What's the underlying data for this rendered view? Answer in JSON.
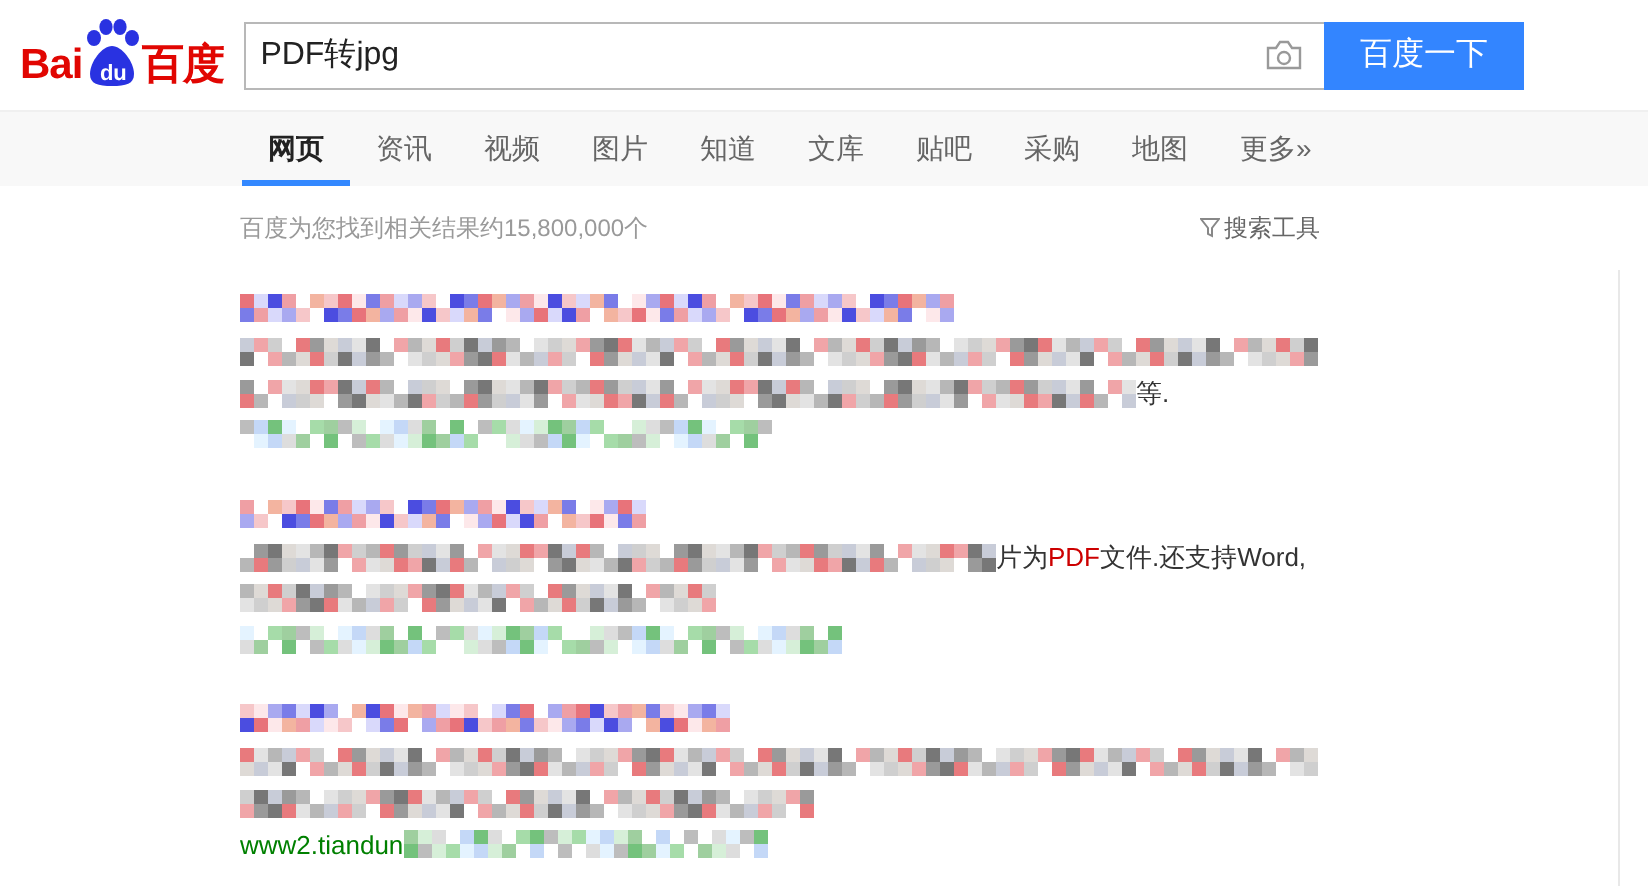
{
  "logo": {
    "left": "Bai",
    "badge": "du",
    "right": "百度"
  },
  "search": {
    "value": "PDF转jpg",
    "button": "百度一下"
  },
  "tabs": [
    {
      "label": "网页",
      "selected": true
    },
    {
      "label": "资讯",
      "selected": false
    },
    {
      "label": "视频",
      "selected": false
    },
    {
      "label": "图片",
      "selected": false
    },
    {
      "label": "知道",
      "selected": false
    },
    {
      "label": "文库",
      "selected": false
    },
    {
      "label": "贴吧",
      "selected": false
    },
    {
      "label": "采购",
      "selected": false
    },
    {
      "label": "地图",
      "selected": false
    },
    {
      "label": "更多»",
      "selected": false
    }
  ],
  "result_count": "百度为您找到相关结果约15,800,000个",
  "search_tools": "搜索工具",
  "results": [
    {
      "lines": [
        {
          "kind": "title"
        },
        {
          "kind": "body"
        },
        {
          "kind": "body",
          "after": [
            {
              "text": "等.",
              "highlight": false
            }
          ]
        },
        {
          "kind": "url"
        }
      ]
    },
    {
      "lines": [
        {
          "kind": "title"
        },
        {
          "kind": "body",
          "after": [
            {
              "text": "片为",
              "highlight": false
            },
            {
              "text": "PDF",
              "highlight": true
            },
            {
              "text": "文件.还支持Word,",
              "highlight": false
            }
          ]
        },
        {
          "kind": "body"
        },
        {
          "kind": "url"
        }
      ]
    },
    {
      "lines": [
        {
          "kind": "title"
        },
        {
          "kind": "body"
        },
        {
          "kind": "body"
        },
        {
          "kind": "url",
          "before": "www2.tiandun"
        }
      ]
    }
  ]
}
